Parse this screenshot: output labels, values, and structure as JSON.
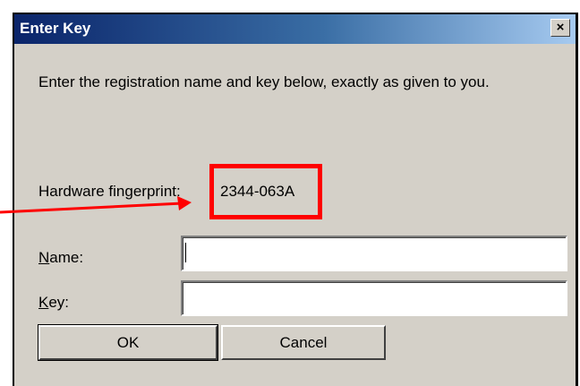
{
  "dialog": {
    "title": "Enter Key",
    "close_glyph": "×",
    "instruction": "Enter the registration name and key below, exactly as given to you.",
    "fingerprint_label": "Hardware fingerprint:",
    "fingerprint_value": "2344-063A"
  },
  "form": {
    "name": {
      "label_access_key": "N",
      "label_rest": "ame:",
      "value": ""
    },
    "key": {
      "label_access_key": "K",
      "label_rest": "ey:",
      "value": ""
    }
  },
  "buttons": {
    "ok": "OK",
    "cancel": "Cancel"
  },
  "annotation": {
    "color": "#ff0000"
  },
  "colors": {
    "face": "#d4d0c8",
    "title_start": "#0a246a",
    "title_end": "#a6caf0"
  }
}
